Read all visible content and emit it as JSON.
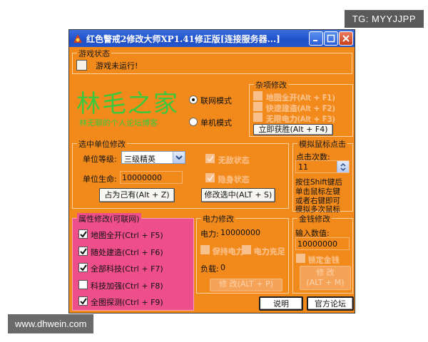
{
  "watermarks": {
    "top": "TG: MYYJJPP",
    "bottom": "www.dhwein.com"
  },
  "window": {
    "title": "红色警戒2修改大师XP1.41修正版[连接服务器...]"
  },
  "game_status": {
    "label": "游戏状态",
    "value": "游戏未运行!"
  },
  "logo": {
    "name": "林毛之家",
    "slogan": "林无聊的个人论坛博客"
  },
  "mode": {
    "online": "联网模式",
    "single": "单机模式",
    "selected": "online"
  },
  "misc": {
    "label": "杂项修改",
    "items": [
      "地图全开(Alt + F1)",
      "快速建造(Alt + F2)",
      "无限电力(Alt + F3)"
    ],
    "win_button": "立即获胜(Alt + F4)"
  },
  "unit": {
    "label": "选中单位修改",
    "level_label": "单位等级:",
    "level_value": "三级精英",
    "life_label": "单位生命:",
    "life_value": "10000000",
    "opt1": "无敌状态",
    "opt2": "隐身状态",
    "own_button": "占为己有(Alt + Z)",
    "modify_button": "修改选中(ALT + S)"
  },
  "mouse": {
    "label": "模拟鼠标点击",
    "count_label": "点击次数:",
    "count_value": "11",
    "hint": [
      "按住Shift键后",
      "单击鼠标左键",
      "或者右键即可",
      "模拟多次鼠标"
    ]
  },
  "attrs": {
    "label": "属性修改(可联网)",
    "items": [
      {
        "label": "地图全开(Ctrl + F5)",
        "checked": true
      },
      {
        "label": "随处建造(Ctrl + F6)",
        "checked": true
      },
      {
        "label": "全部科技(Ctrl + F7)",
        "checked": true
      },
      {
        "label": "科技加强(Ctrl + F8)",
        "checked": false
      },
      {
        "label": "全图探测(Ctrl + F9)",
        "checked": true
      }
    ]
  },
  "power": {
    "label": "电力修改",
    "power_label": "电力:",
    "power_value": "10000000",
    "opt1": "保持电力",
    "opt2": "电力充足",
    "load_label": "负载:",
    "load_value": "0",
    "button": "修 改(ALT + P)"
  },
  "money": {
    "label": "金钱修改",
    "input_label": "输入数值:",
    "input_value": "10000000",
    "opt": "锁定金钱",
    "button_line1": "修 改",
    "button_line2": "(ALT + M)"
  },
  "bottom": {
    "help": "说明",
    "forum": "官方论坛"
  },
  "colors": {
    "window_bg": "#f28a1b",
    "attrs_bg": "#ee4e8a",
    "logo": "#3cc83c"
  }
}
